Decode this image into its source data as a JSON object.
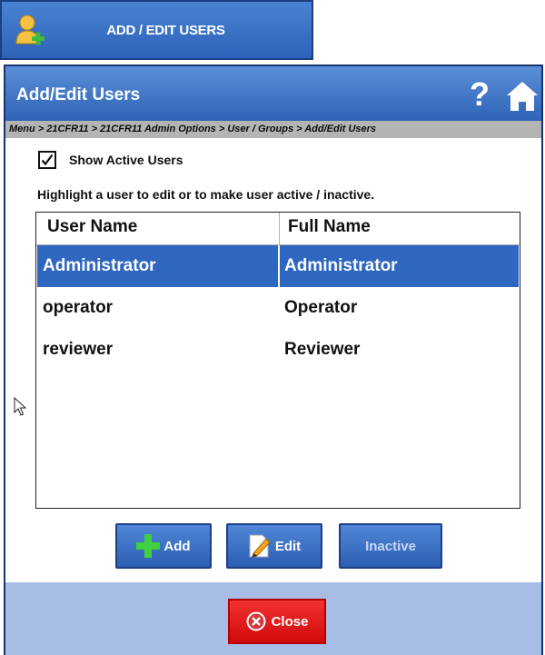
{
  "launcher": {
    "label": "ADD / EDIT USERS",
    "icon": "add-user-icon"
  },
  "dialog": {
    "title": "Add/Edit Users",
    "help_icon": "question-mark-icon",
    "home_icon": "home-icon",
    "breadcrumb": "Menu > 21CFR11 > 21CFR11 Admin Options > User / Groups > Add/Edit Users",
    "show_active": {
      "label": "Show Active Users",
      "checked": true
    },
    "instruction": "Highlight a user to edit or to make user active / inactive.",
    "table": {
      "columns": [
        "User Name",
        "Full Name"
      ],
      "rows": [
        {
          "user": "Administrator",
          "full": "Administrator",
          "selected": true
        },
        {
          "user": "operator",
          "full": "Operator",
          "selected": false
        },
        {
          "user": "reviewer",
          "full": "Reviewer",
          "selected": false
        }
      ]
    },
    "buttons": {
      "add": "Add",
      "edit": "Edit",
      "inactive": "Inactive",
      "close": "Close"
    }
  },
  "colors": {
    "title_bar": "#2f63b6",
    "selected_row": "#2f66c0",
    "footer": "#a7bde6",
    "close_button": "#d10a0a"
  }
}
